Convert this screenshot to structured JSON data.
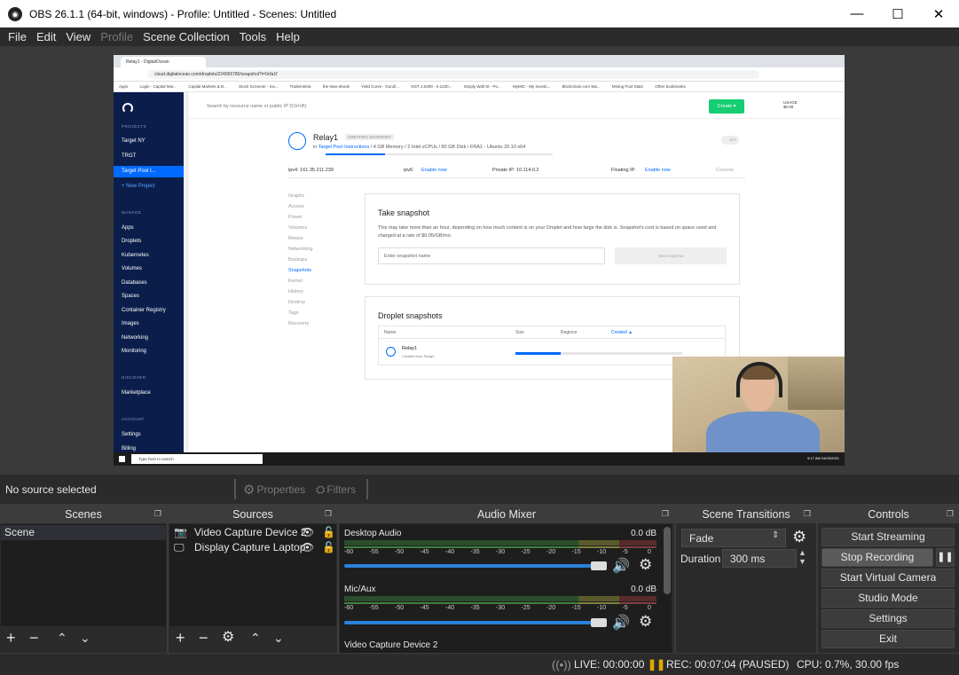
{
  "window": {
    "title": "OBS 26.1.1 (64-bit, windows) - Profile: Untitled - Scenes: Untitled",
    "minimize": "—",
    "maximize": "☐",
    "close": "✕"
  },
  "menu": [
    "File",
    "Edit",
    "View",
    "Profile",
    "Scene Collection",
    "Tools",
    "Help"
  ],
  "browser": {
    "tab": "Relay1 - DigitalOcean",
    "url": "cloud.digitalocean.com/droplets/224056780/snapshot?i=0cfa1f",
    "bookmarks": [
      "Apps",
      "Login - Capital Mar...",
      "Capital Markets & B...",
      "Stock Screener - Inv...",
      "Trademetria",
      "the-stan-ebook",
      "Yield Curve - Gurufi...",
      "NGT 2.5400 - 0.1230...",
      "Simply Wall St - Po...",
      "MyMIC - My Investi...",
      "Blockchain.com Wa...",
      "Mining Pool Stats",
      "Other bookmarks"
    ]
  },
  "do": {
    "search": "Search by resource name or public IP (Ctrl+B)",
    "create": "Create ▾",
    "usage": "USAGE",
    "usage_amt": "$0.00",
    "projects_label": "PROJECTS",
    "projects": [
      "Target NY",
      "TRGT",
      "Target Pool I...",
      "+ New Project"
    ],
    "manage_label": "MANAGE",
    "manage": [
      "Apps",
      "Droplets",
      "Kubernetes",
      "Volumes",
      "Databases",
      "Spaces",
      "Container Registry",
      "Images",
      "Networking",
      "Monitoring"
    ],
    "new_badge": "NEW",
    "discover_label": "DISCOVER",
    "discover": [
      "Marketplace"
    ],
    "account_label": "ACCOUNT",
    "account": [
      "Settings",
      "Billing"
    ],
    "droplet_name": "Relay1",
    "droplet_badge": "CREATING SNAPSHOT",
    "droplet_in": "in",
    "droplet_project": "Target Pool Instructions",
    "droplet_specs": "/ 4 GB Memory / 2 Intel vCPUs / 80 GB Disk / FRA1 - Ubuntu 20.10 x64",
    "off": "OFF",
    "ipv4": "ipv4: 161.35.211.239",
    "ipv6": "ipv6:",
    "ipv6_link": "Enable now",
    "private": "Private IP: 10.114.0.2",
    "floating": "Floating IP:",
    "floating_link": "Enable now",
    "console": "Console",
    "nav": [
      "Graphs",
      "Access",
      "Power",
      "Volumes",
      "Resize",
      "Networking",
      "Backups",
      "Snapshots",
      "Kernel",
      "History",
      "Destroy",
      "Tags",
      "Recovery"
    ],
    "snap_title": "Take snapshot",
    "snap_desc": "This may take more than an hour, depending on how much content is on your Droplet and how large the disk is. Snapshot's cost is based on space used and charged at a rate of $0.05/GB/mo.",
    "snap_placeholder": "Enter snapshot name",
    "snap_button": "Take snapshot",
    "ds_title": "Droplet snapshots",
    "ds_cols": [
      "Name",
      "Size",
      "Regions",
      "Created ▲"
    ],
    "ds_row_name": "Relay1",
    "ds_row_sub": "Created from Relay1",
    "ds_progress": 0.27,
    "droplet_progress": 0.26
  },
  "taskbar": {
    "search": "Type here to search",
    "time": "9:17 AM",
    "date": "04/03/2021"
  },
  "status": {
    "no_source": "No source selected",
    "properties": "Properties",
    "filters": "Filters"
  },
  "docks": {
    "scenes": "Scenes",
    "sources": "Sources",
    "mixer": "Audio Mixer",
    "transitions": "Scene Transitions",
    "controls": "Controls"
  },
  "scenes": [
    "Scene"
  ],
  "sources": [
    "Video Capture Device 2",
    "Display Capture Laptop"
  ],
  "mixer": {
    "channels": [
      {
        "name": "Desktop Audio",
        "db": "0.0 dB",
        "volume": 1.0
      },
      {
        "name": "Mic/Aux",
        "db": "0.0 dB",
        "volume": 1.0
      },
      {
        "name": "Video Capture Device 2",
        "db": ""
      }
    ],
    "ticks": [
      "-60",
      "-55",
      "-50",
      "-45",
      "-40",
      "-35",
      "-30",
      "-25",
      "-20",
      "-15",
      "-10",
      "-5",
      "0"
    ]
  },
  "transitions": {
    "type": "Fade",
    "duration_label": "Duration",
    "duration": "300 ms"
  },
  "controls": [
    "Start Streaming",
    "Stop Recording",
    "Start Virtual Camera",
    "Studio Mode",
    "Settings",
    "Exit"
  ],
  "footer": {
    "live": "LIVE: 00:00:00",
    "rec": "REC: 00:07:04 (PAUSED)",
    "cpu": "CPU: 0.7%, 30.00 fps"
  }
}
